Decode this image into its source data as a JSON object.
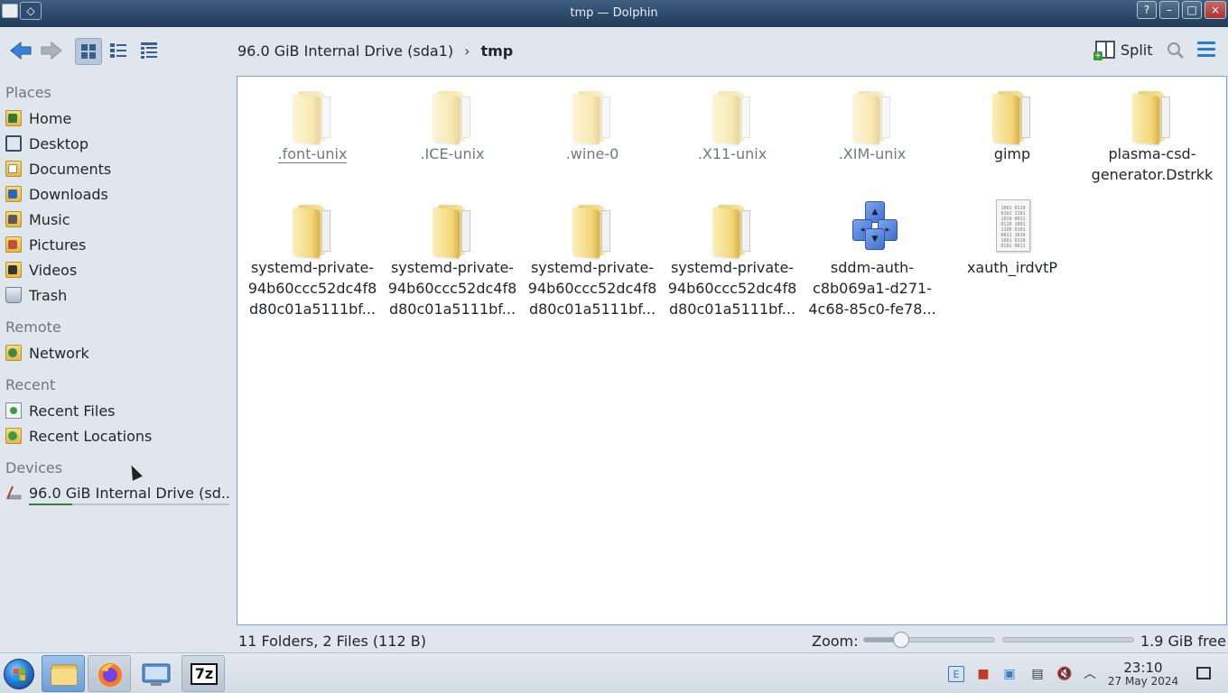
{
  "window": {
    "title": "tmp — Dolphin",
    "buttons": {
      "help": "?",
      "minimize": "–",
      "maximize": "□",
      "close": "×"
    }
  },
  "toolbar": {
    "back_icon": "back-arrow",
    "forward_icon": "forward-arrow",
    "view_modes": [
      "icons",
      "compact",
      "details"
    ],
    "breadcrumb": [
      "96.0 GiB Internal Drive (sda1)",
      "tmp"
    ],
    "breadcrumb_separator": "›",
    "split_label": "Split",
    "search_icon": "search",
    "menu_icon": "hamburger"
  },
  "sidebar": {
    "places_label": "Places",
    "places": [
      {
        "label": "Home",
        "icon": "home-folder"
      },
      {
        "label": "Desktop",
        "icon": "desktop"
      },
      {
        "label": "Documents",
        "icon": "documents-folder"
      },
      {
        "label": "Downloads",
        "icon": "downloads-folder"
      },
      {
        "label": "Music",
        "icon": "music-folder"
      },
      {
        "label": "Pictures",
        "icon": "pictures-folder"
      },
      {
        "label": "Videos",
        "icon": "videos-folder"
      },
      {
        "label": "Trash",
        "icon": "trash"
      }
    ],
    "remote_label": "Remote",
    "remote": [
      {
        "label": "Network",
        "icon": "network-folder"
      }
    ],
    "recent_label": "Recent",
    "recent": [
      {
        "label": "Recent Files",
        "icon": "recent-files"
      },
      {
        "label": "Recent Locations",
        "icon": "recent-locations"
      }
    ],
    "devices_label": "Devices",
    "devices": [
      {
        "label": "96.0 GiB Internal Drive (sd...",
        "icon": "drive",
        "usage": 0.22
      }
    ]
  },
  "files": [
    {
      "name": ".font-unix",
      "type": "folder",
      "hidden": true,
      "focused": true
    },
    {
      "name": ".ICE-unix",
      "type": "folder",
      "hidden": true
    },
    {
      "name": ".wine-0",
      "type": "folder",
      "hidden": true
    },
    {
      "name": ".X11-unix",
      "type": "folder",
      "hidden": true
    },
    {
      "name": ".XIM-unix",
      "type": "folder",
      "hidden": true
    },
    {
      "name": "gimp",
      "type": "folder"
    },
    {
      "name": "plasma-csd-generator.Dstrkk",
      "type": "folder"
    },
    {
      "name": "systemd-private-94b60ccc52dc4f8d80c01a5111bf...",
      "type": "folder"
    },
    {
      "name": "systemd-private-94b60ccc52dc4f8d80c01a5111bf...",
      "type": "folder"
    },
    {
      "name": "systemd-private-94b60ccc52dc4f8d80c01a5111bf...",
      "type": "folder"
    },
    {
      "name": "systemd-private-94b60ccc52dc4f8d80c01a5111bf...",
      "type": "folder"
    },
    {
      "name": "sddm-auth-c8b069a1-d271-4c68-85c0-fe78...",
      "type": "file",
      "icon": "sddm-cubes"
    },
    {
      "name": "xauth_irdvtP",
      "type": "file",
      "icon": "text-document"
    }
  ],
  "status": {
    "summary": "11 Folders, 2 Files (112 B)",
    "zoom_label": "Zoom:",
    "zoom_level": 0.28,
    "free_space": "1.9 GiB free"
  },
  "taskbar": {
    "apps": [
      "file-manager",
      "firefox",
      "system-settings",
      "7zip"
    ],
    "sevenzip_label": "7z",
    "tray_icons": [
      "e-icon",
      "red-app-icon",
      "clipboard-icon",
      "battery-icon",
      "volume-muted-icon",
      "up-chevron-icon"
    ],
    "time": "23:10",
    "date": "27 May 2024"
  },
  "colors": {
    "accent": "#2a7ad4",
    "titlebar": "#2b4a6b",
    "folder": "#f3d87a",
    "view_border": "#7ba3cf"
  }
}
